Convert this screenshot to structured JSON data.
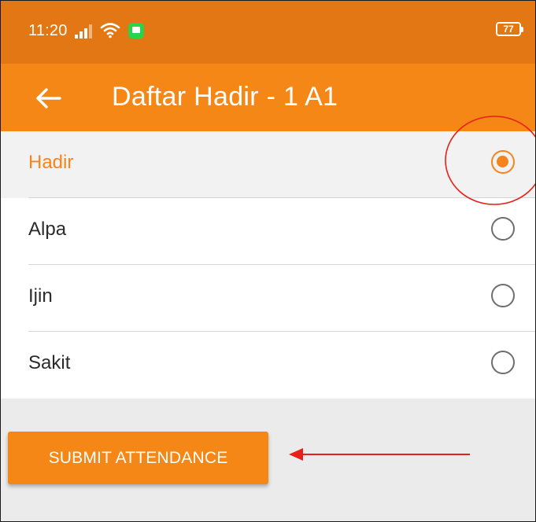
{
  "status_bar": {
    "time": "11:20",
    "battery": "77",
    "background_color": "#e37714",
    "icons": [
      "signal-icon",
      "wifi-icon",
      "chat-notification-icon",
      "battery-icon"
    ]
  },
  "app_bar": {
    "title": "Daftar Hadir - 1 A1",
    "back_icon": "arrow-left-icon",
    "background_color": "#f58717"
  },
  "attendance_options": [
    {
      "label": "Hadir",
      "selected": true
    },
    {
      "label": "Alpa",
      "selected": false
    },
    {
      "label": "Ijin",
      "selected": false
    },
    {
      "label": "Sakit",
      "selected": false
    }
  ],
  "submit": {
    "label": "SUBMIT ATTENDANCE"
  },
  "annotation": {
    "highlight_color": "#e8201a"
  },
  "accent_color": "#f5841c"
}
